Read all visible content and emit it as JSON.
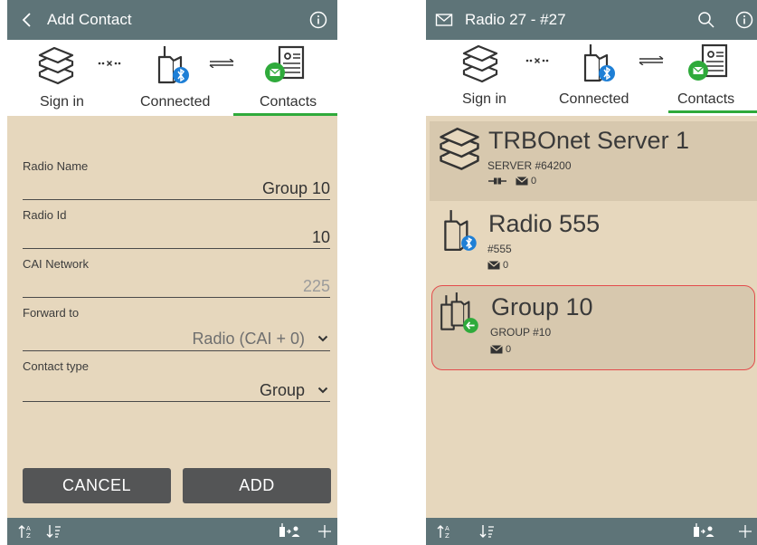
{
  "left": {
    "title": "Add Contact",
    "steps": {
      "signin": "Sign in",
      "connected": "Connected",
      "contacts": "Contacts"
    },
    "fields": [
      {
        "label": "Radio Name",
        "value": "Group 10"
      },
      {
        "label": "Radio Id",
        "value": "10"
      },
      {
        "label": "CAI Network",
        "value": "225"
      },
      {
        "label": "Forward to",
        "value": "Radio (CAI + 0)"
      },
      {
        "label": "Contact type",
        "value": "Group"
      }
    ],
    "buttons": {
      "cancel": "CANCEL",
      "add": "ADD"
    }
  },
  "right": {
    "title": "Radio 27 - #27",
    "steps": {
      "signin": "Sign in",
      "connected": "Connected",
      "contacts": "Contacts"
    },
    "contacts": [
      {
        "name": "TRBOnet Server 1",
        "sub": "SERVER #64200",
        "messages": "0"
      },
      {
        "name": "Radio 555",
        "sub": "#555",
        "messages": "0"
      },
      {
        "name": "Group 10",
        "sub": "GROUP #10",
        "messages": "0"
      }
    ]
  },
  "colors": {
    "bar": "#5e7478",
    "background": "#e6d7bd",
    "accent": "#2faa3b",
    "bluetooth": "#1e7fd6",
    "selection": "#e34c4c"
  },
  "icons": [
    "back-icon",
    "info-icon",
    "mail-icon",
    "search-icon",
    "server-icon",
    "radio-icon",
    "contacts-card-icon",
    "bluetooth-icon",
    "sort-alpha-icon",
    "sort-list-icon",
    "add-contact-icon",
    "plus-icon"
  ]
}
